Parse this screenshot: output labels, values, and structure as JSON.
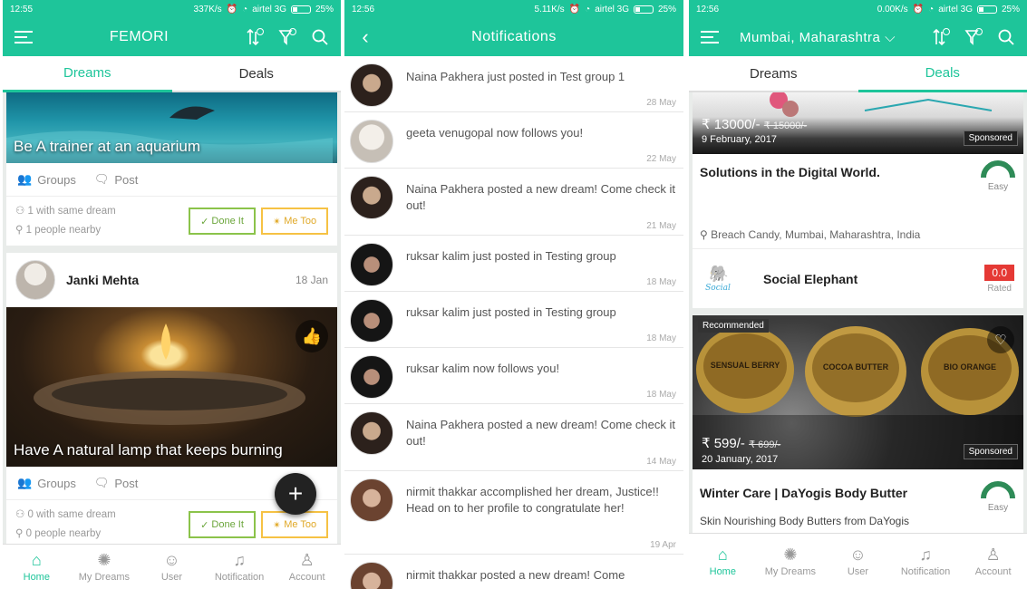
{
  "statusbar": {
    "p1": {
      "time": "12:55",
      "speed": "337K/s",
      "carrier": "airtel 3G",
      "battery": "25%"
    },
    "p2": {
      "time": "12:56",
      "speed": "5.11K/s",
      "carrier": "airtel 3G",
      "battery": "25%"
    },
    "p3": {
      "time": "12:56",
      "speed": "0.00K/s",
      "carrier": "airtel 3G",
      "battery": "25%"
    }
  },
  "screen1": {
    "title": "FEMORI",
    "tabs": [
      "Dreams",
      "Deals"
    ],
    "card1": {
      "caption": "Be A trainer at an aquarium",
      "groups": "Groups",
      "post": "Post",
      "same_dream": "1 with same dream",
      "nearby": "1 people nearby",
      "done": "Done It",
      "metoo": "Me Too"
    },
    "card2": {
      "user": "Janki Mehta",
      "date": "18 Jan",
      "caption": "Have A natural lamp that keeps burning",
      "groups": "Groups",
      "post": "Post",
      "same_dream": "0 with same dream",
      "nearby": "0 people nearby",
      "done": "Done It",
      "metoo": "Me Too"
    },
    "fab": "+",
    "nav": [
      "Home",
      "My Dreams",
      "User",
      "Notification",
      "Account"
    ]
  },
  "screen2": {
    "title": "Notifications",
    "items": [
      {
        "text": "Naina Pakhera just posted in Test group 1",
        "date": "28 May"
      },
      {
        "text": "geeta venugopal now follows you!",
        "date": "22 May"
      },
      {
        "text": "Naina Pakhera posted a new dream! Come check it out!",
        "date": "21 May"
      },
      {
        "text": "ruksar kalim just posted in Testing group",
        "date": "18 May"
      },
      {
        "text": "ruksar kalim just posted in Testing group",
        "date": "18 May"
      },
      {
        "text": "ruksar kalim now follows you!",
        "date": "18 May"
      },
      {
        "text": "Naina Pakhera posted a new dream! Come check it out!",
        "date": "14 May"
      },
      {
        "text": "nirmit thakkar accomplished her dream, Justice!! Head on to her profile to congratulate her!",
        "date": "19 Apr"
      },
      {
        "text": "nirmit thakkar posted a new dream! Come",
        "date": ""
      }
    ]
  },
  "screen3": {
    "location": "Mumbai, Maharashtra",
    "tabs": [
      "Dreams",
      "Deals"
    ],
    "deal1": {
      "price": "₹ 13000/-",
      "old_price": "₹ 15000/-",
      "date": "9 February, 2017",
      "sponsored": "Sponsored",
      "title": "Solutions in the Digital World.",
      "difficulty": "Easy",
      "address": "Breach Candy, Mumbai, Maharashtra, India",
      "vendor": "Social Elephant",
      "vendor_logo": "Social",
      "rating": "0.0",
      "rated": "Rated"
    },
    "deal2": {
      "badge": "Recommended",
      "price": "₹ 599/-",
      "old_price": "₹ 699/-",
      "date": "20 January, 2017",
      "sponsored": "Sponsored",
      "title": "Winter Care | DaYogis Body Butter",
      "difficulty": "Easy",
      "subtitle": "Skin Nourishing Body Butters from DaYogis",
      "jar_labels": [
        "SENSUAL BERRY",
        "COCOA BUTTER",
        "BIO ORANGE"
      ]
    },
    "nav": [
      "Home",
      "My Dreams",
      "User",
      "Notification",
      "Account"
    ]
  },
  "colors": {
    "accent": "#1ec59a",
    "done": "#8bc34a",
    "metoo": "#f6c244",
    "rating": "#e53935"
  }
}
